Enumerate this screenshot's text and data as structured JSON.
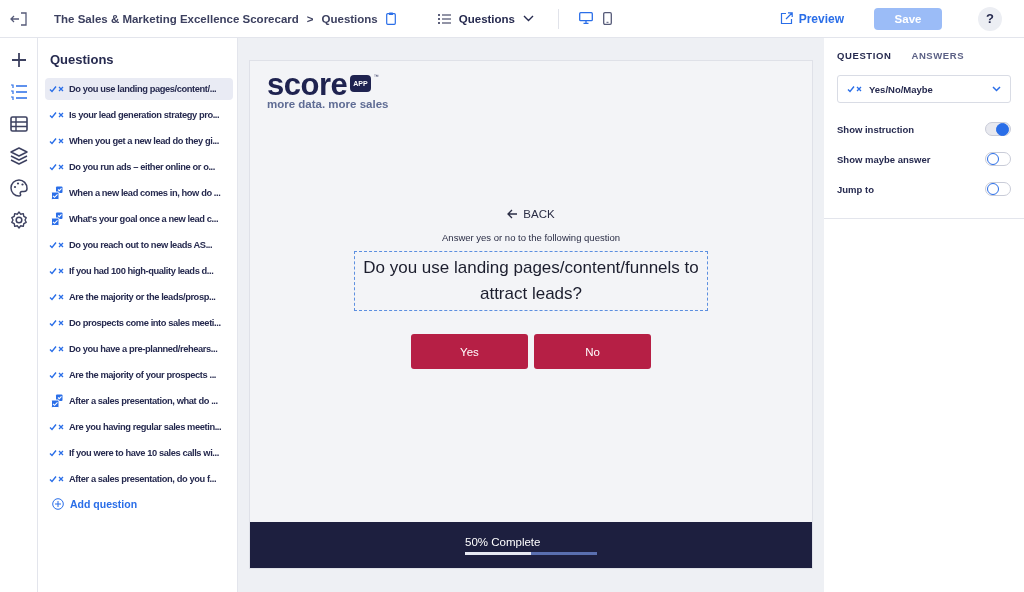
{
  "topbar": {
    "breadcrumb": "The Sales & Marketing Excellence Scorecard",
    "separator": ">",
    "current": "Questions",
    "view_menu": "Questions",
    "devices": [
      {
        "kind": "desktop",
        "selected": true
      },
      {
        "kind": "mobile",
        "selected": false
      }
    ],
    "preview": "Preview",
    "save": {
      "label": "Save",
      "disabled": true
    },
    "help": "?"
  },
  "rail": [
    {
      "kind": "plus",
      "selected": false
    },
    {
      "kind": "list",
      "selected": true
    },
    {
      "kind": "table",
      "selected": false
    },
    {
      "kind": "layers",
      "selected": false
    },
    {
      "kind": "palette",
      "selected": false
    },
    {
      "kind": "gear",
      "selected": false
    }
  ],
  "questions": {
    "title": "Questions",
    "items": [
      {
        "kind": "yesno",
        "text": "Do you use landing pages/content/...",
        "selected": true
      },
      {
        "kind": "yesno",
        "text": "Is your lead generation strategy pro...",
        "selected": false
      },
      {
        "kind": "yesno",
        "text": "When you get a new lead do they gi...",
        "selected": false
      },
      {
        "kind": "yesno",
        "text": "Do you run ads – either online or o...",
        "selected": false
      },
      {
        "kind": "multi",
        "text": "When a new lead comes in, how do ...",
        "selected": false
      },
      {
        "kind": "multi",
        "text": "What's your goal once a new lead c...",
        "selected": false
      },
      {
        "kind": "yesno",
        "text": "Do you reach out to new leads AS...",
        "selected": false
      },
      {
        "kind": "yesno",
        "text": "If you had 100 high-quality leads d...",
        "selected": false
      },
      {
        "kind": "yesno",
        "text": "Are the majority or the leads/prosp...",
        "selected": false
      },
      {
        "kind": "yesno",
        "text": "Do prospects come into sales meeti...",
        "selected": false
      },
      {
        "kind": "yesno",
        "text": "Do you have a pre-planned/rehears...",
        "selected": false
      },
      {
        "kind": "yesno",
        "text": "Are the majority of your prospects ...",
        "selected": false
      },
      {
        "kind": "multi",
        "text": "After a sales presentation, what do ...",
        "selected": false
      },
      {
        "kind": "yesno",
        "text": "Are you having regular sales meetin...",
        "selected": false
      },
      {
        "kind": "yesno",
        "text": "If you were to have 10 sales calls wi...",
        "selected": false
      },
      {
        "kind": "yesno",
        "text": "After a sales presentation, do you f...",
        "selected": false
      }
    ],
    "add": "Add question"
  },
  "preview": {
    "logo": {
      "name": "score",
      "badge": "APP",
      "tm": "™",
      "tagline": "more data. more sales"
    },
    "back": "BACK",
    "instruction": "Answer yes or no to the following question",
    "question": "Do you use landing pages/content/funnels to attract leads?",
    "answers": [
      "Yes",
      "No"
    ],
    "progress": {
      "text": "50% Complete",
      "level": 0.5
    }
  },
  "settings": {
    "tabs": [
      {
        "label": "QUESTION",
        "selected": true
      },
      {
        "label": "ANSWERS",
        "selected": false
      }
    ],
    "type": "Yes/No/Maybe",
    "toggles": [
      {
        "label": "Show instruction",
        "on": true
      },
      {
        "label": "Show maybe answer",
        "on": false
      },
      {
        "label": "Jump to",
        "on": false
      }
    ]
  }
}
